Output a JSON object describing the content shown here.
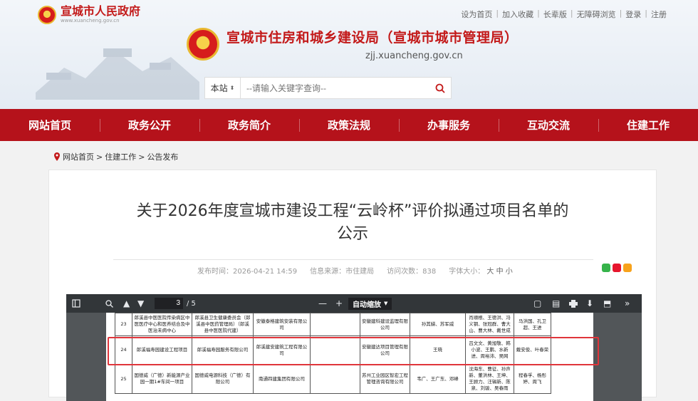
{
  "portal": {
    "title": "宣城市人民政府",
    "domain": "www.xuancheng.gov.cn"
  },
  "toplinks": [
    "设为首页",
    "加入收藏",
    "长辈版",
    "无障碍浏览",
    "登录",
    "注册"
  ],
  "bureau": {
    "title": "宣城市住房和城乡建设局（宣城市城市管理局）",
    "domain": "zjj.xuancheng.gov.cn"
  },
  "search": {
    "scope": "本站",
    "placeholder": "--请输入关键字查询--"
  },
  "nav": [
    "网站首页",
    "政务公开",
    "政务简介",
    "政策法规",
    "办事服务",
    "互动交流",
    "住建工作"
  ],
  "breadcrumb": {
    "home": "网站首页",
    "sep": ">",
    "section": "住建工作",
    "page": "公告发布"
  },
  "article": {
    "title_line1": "关于2026年度宣城市建设工程“云岭杯”评价拟通过项目名单的",
    "title_line2": "公示",
    "publish": "发布时间：2026-04-21 14:59",
    "source": "信息来源：市住建局",
    "views": "访问次数：838",
    "fontsize_label": "字体大小：",
    "font_large": "大",
    "font_mid": "中",
    "font_small": "小"
  },
  "pdf": {
    "page": "3",
    "total": "/ 5",
    "zoom": "自动缩放",
    "minus": "—",
    "plus": "+"
  },
  "colors": {
    "brand_red": "#b5121b",
    "title_red": "#c31a1a",
    "highlight": "#e0353b"
  },
  "table_rows": [
    {
      "no": "23",
      "project": "郎溪县中医医院传染病区中医医疗中心和医养结合及中医治未病中心",
      "owner": "郎溪县卫生健康委员会（郎溪县中医药管理局）（郎溪县中医医院代建）",
      "builder": "安徽泰格建筑安装有限公司",
      "c5": "",
      "supervisor": "安徽建科建设监理有限公司",
      "manager": "孙其娣、苏军威",
      "team": "肖顺根、王德洪、冯义钢、张冠群、曹大山、曹大林、戴世成",
      "c9": "马洪国、孔卫超、王进"
    },
    {
      "no": "24",
      "project": "郎溪福寿园建设工程项目",
      "owner": "郎溪福寿园服务有限公司",
      "builder": "郎溪建安建筑工程有限公司",
      "c5": "",
      "supervisor": "安徽建达项目管理有限公司",
      "manager": "王晓",
      "team": "吕文文、黄旭敬、韩小波、王鹏、水新进、周裕沛、吴网",
      "c9": "戴安俊、叶春荣"
    },
    {
      "no": "25",
      "project": "国德威（广德）新能源产业园一期1#车间一项目",
      "owner": "国德威电源科技（广德）有限公司",
      "builder": "南通四建集团有限公司",
      "c5": "",
      "supervisor": "苏州工业园区智宏工程管理咨询有限公司",
      "manager": "韦广、王广东、邓峰",
      "team": "沈海东、曹征、孙声新、董洪林、王坤、王顾力、汪锡新、陈泉、刘骏、吴春雨",
      "c9": "程春孚、杨彤婷、周飞"
    }
  ]
}
